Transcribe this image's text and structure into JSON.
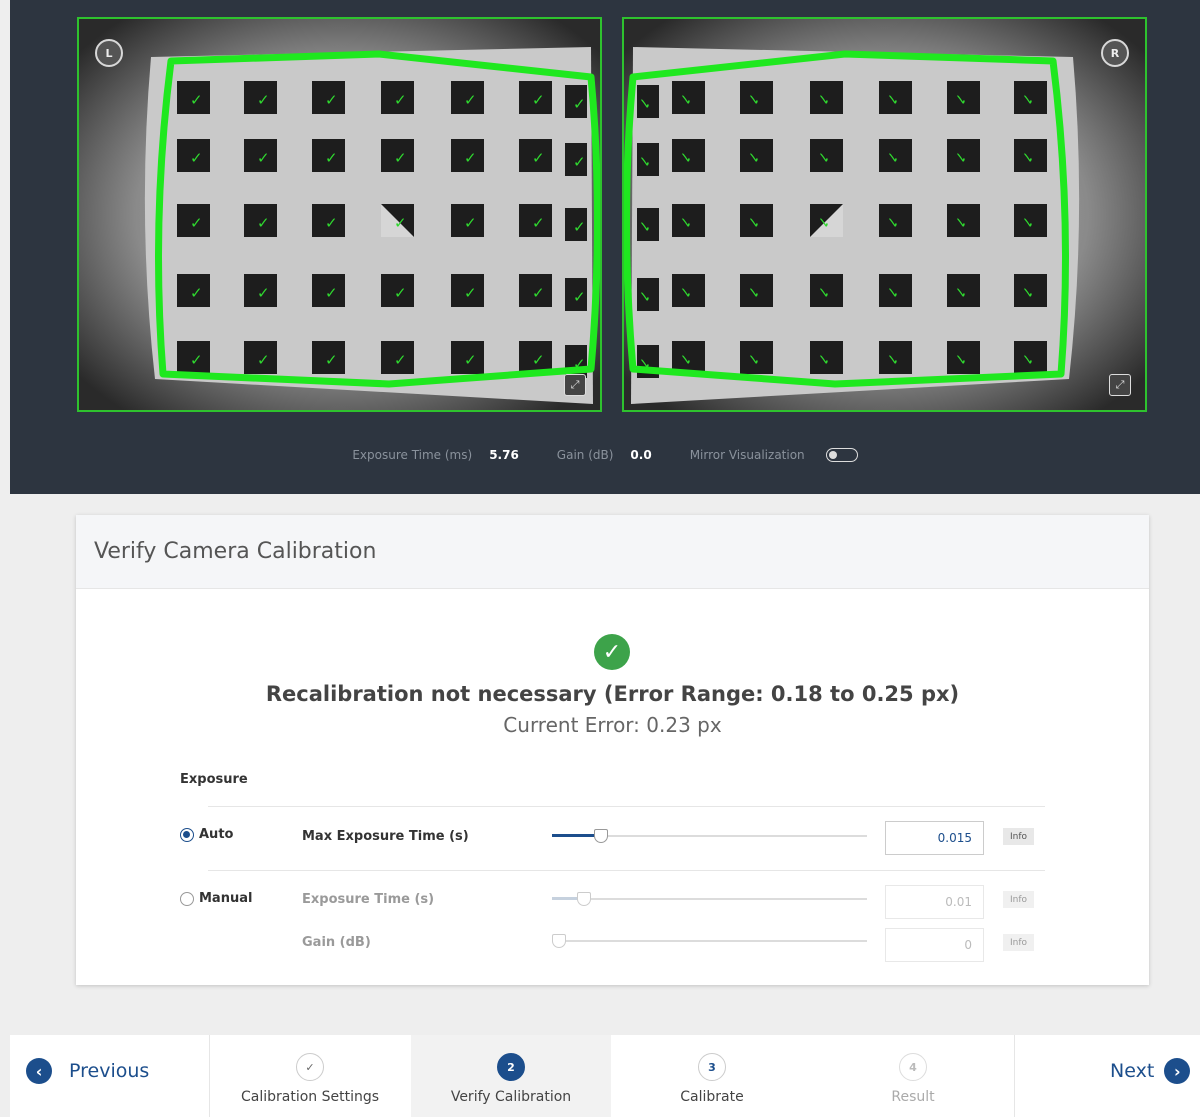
{
  "cameras": {
    "left_badge": "L",
    "right_badge": "R"
  },
  "status": {
    "exposure_label": "Exposure Time (ms)",
    "exposure_value": "5.76",
    "gain_label": "Gain (dB)",
    "gain_value": "0.0",
    "mirror_label": "Mirror Visualization",
    "mirror_on": false
  },
  "card": {
    "title": "Verify Camera Calibration",
    "result_title": "Recalibration not necessary (Error Range: 0.18 to 0.25 px)",
    "result_sub": "Current Error: 0.23 px",
    "exposure_section": "Exposure",
    "auto": {
      "label": "Auto",
      "selected": true,
      "param_label": "Max Exposure Time (s)",
      "value": "0.015",
      "slider_fraction": 0.155,
      "info": "Info"
    },
    "manual": {
      "label": "Manual",
      "selected": false,
      "exposure_label": "Exposure Time (s)",
      "exposure_value": "0.01",
      "exposure_fraction": 0.1,
      "gain_label": "Gain (dB)",
      "gain_value": "0",
      "gain_fraction": 0,
      "info": "Info"
    }
  },
  "footer": {
    "previous": "Previous",
    "next": "Next",
    "steps": [
      {
        "number": "✓",
        "label": "Calibration Settings",
        "state": "done"
      },
      {
        "number": "2",
        "label": "Verify Calibration",
        "state": "active"
      },
      {
        "number": "3",
        "label": "Calibrate",
        "state": "pending"
      },
      {
        "number": "4",
        "label": "Result",
        "state": "disabled"
      }
    ]
  },
  "colors": {
    "accent": "#1c4e8c",
    "success": "#3da34a",
    "detection": "#2ec22e",
    "dark_bg": "#2d3540"
  }
}
